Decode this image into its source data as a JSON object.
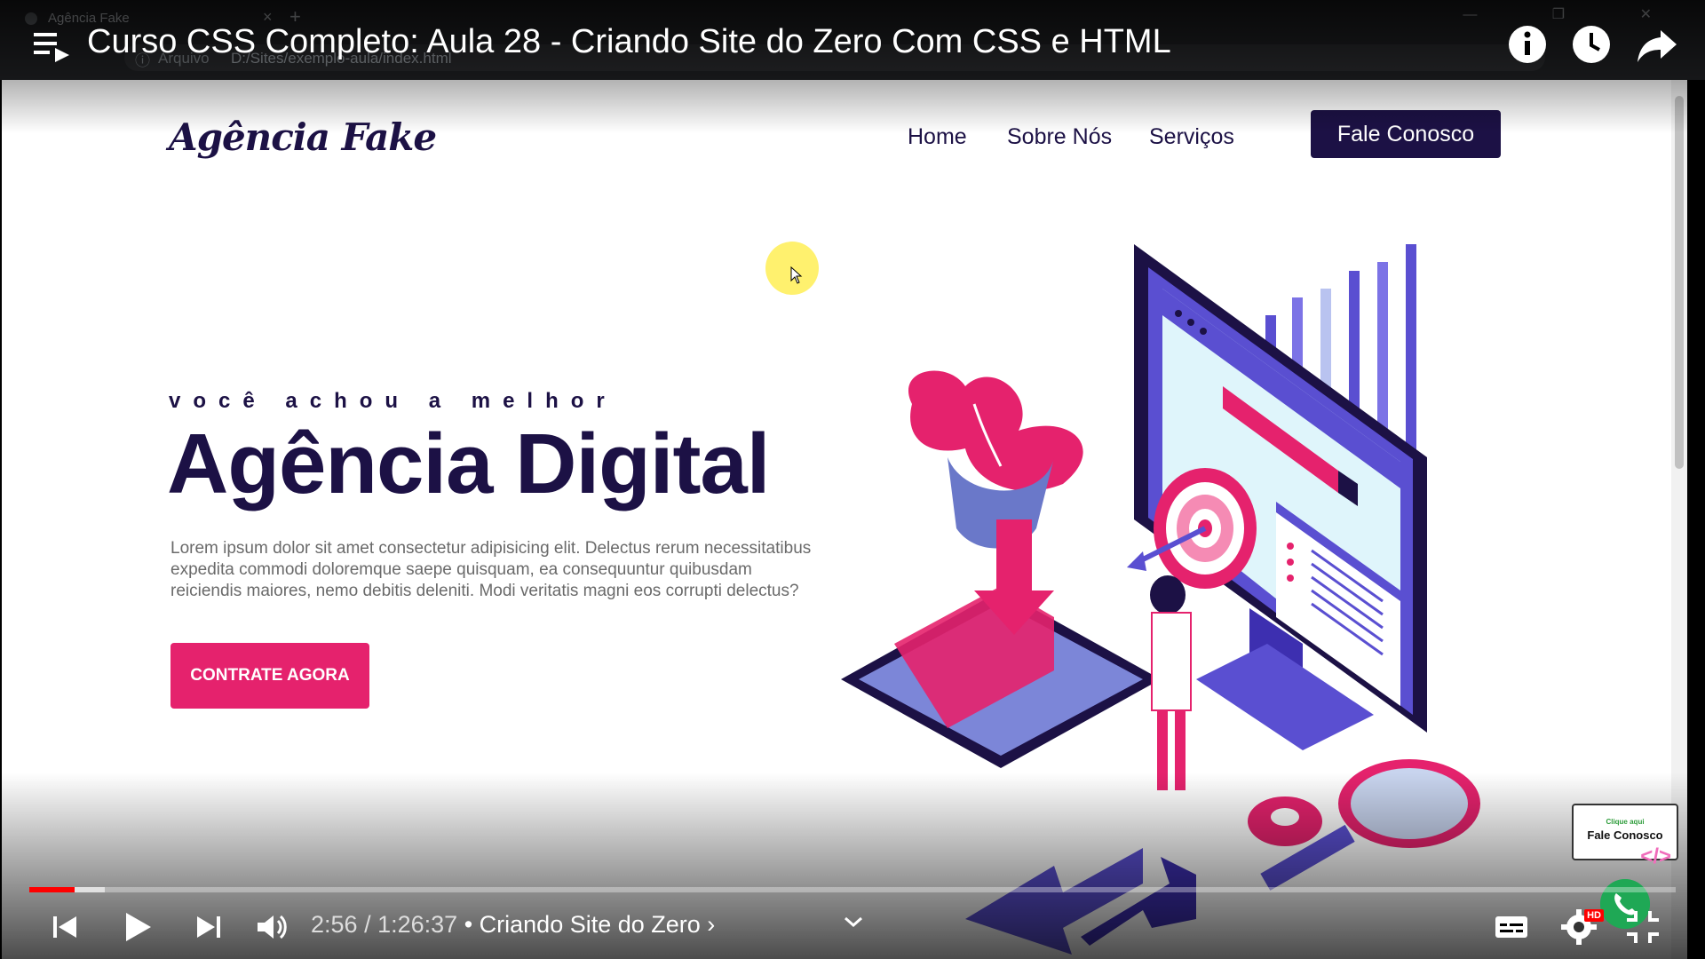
{
  "browser": {
    "tab_title": "Agência Fake",
    "tab_close": "×",
    "new_tab": "+",
    "address_protocol": "Arquivo",
    "address_url": "D:/Sites/exemplo-aula/index.html",
    "window_controls": "—  ❐  ✕"
  },
  "site": {
    "logo": "Agência Fake",
    "nav": [
      "Home",
      "Sobre Nós",
      "Serviços"
    ],
    "cta_label": "Fale Conosco",
    "tagline": "você achou a melhor",
    "hero_title": "Agência Digital",
    "hero_text": "Lorem ipsum dolor sit amet consectetur adipisicing elit. Delectus rerum necessitatibus expedita commodi doloremque saepe quisquam, ea consequuntur quibusdam reiciendis maiores, nemo debitis deleniti. Modi veritatis magni eos corrupti delectus?",
    "hero_button": "CONTRATE AGORA",
    "colors": {
      "navy": "#1c1145",
      "pink": "#e5226d",
      "purple": "#5a4fd1"
    }
  },
  "youtube": {
    "video_title": "Curso CSS Completo: Aula 28 - Criando Site do Zero Com CSS e HTML",
    "current_time": "2:56",
    "duration": "1:26:37",
    "chapter": "• Criando Site do Zero ›",
    "progress_played": 0.0275,
    "progress_buffered": 0.046,
    "hd_badge": "HD",
    "icons": [
      "playlist-icon",
      "info-icon",
      "clock-icon",
      "share-icon",
      "previous-icon",
      "play-icon",
      "next-icon",
      "volume-icon",
      "chevron-down-icon",
      "subtitles-icon",
      "settings-icon",
      "fullscreen-exit-icon",
      "whatsapp-icon"
    ]
  },
  "widget": {
    "small": "Clique aqui",
    "big": "Fale Conosco",
    "code": "</>"
  }
}
